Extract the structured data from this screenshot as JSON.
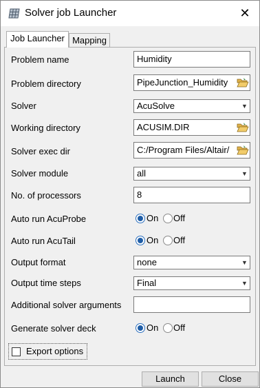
{
  "window": {
    "title": "Solver job Launcher"
  },
  "tabs": [
    {
      "label": "Job Launcher",
      "active": true
    },
    {
      "label": "Mapping",
      "active": false
    }
  ],
  "form": {
    "problem_name": {
      "label": "Problem name",
      "value": "Humidity"
    },
    "problem_directory": {
      "label": "Problem directory",
      "value": "PipeJunction_Humidity"
    },
    "solver": {
      "label": "Solver",
      "value": "AcuSolve"
    },
    "working_directory": {
      "label": "Working directory",
      "value": "ACUSIM.DIR"
    },
    "solver_exec_dir": {
      "label": "Solver exec dir",
      "value": "C:/Program Files/Altair/"
    },
    "solver_module": {
      "label": "Solver module",
      "value": "all"
    },
    "num_processors": {
      "label": "No. of processors",
      "value": "8"
    },
    "auto_run_acuprobe": {
      "label": "Auto run AcuProbe",
      "on_label": "On",
      "off_label": "Off",
      "selected": "On"
    },
    "auto_run_acutail": {
      "label": "Auto run AcuTail",
      "on_label": "On",
      "off_label": "Off",
      "selected": "On"
    },
    "output_format": {
      "label": "Output format",
      "value": "none"
    },
    "output_time_steps": {
      "label": "Output time steps",
      "value": "Final"
    },
    "additional_args": {
      "label": "Additional solver arguments",
      "value": ""
    },
    "generate_solver_deck": {
      "label": "Generate solver deck",
      "on_label": "On",
      "off_label": "Off",
      "selected": "On"
    },
    "export_options": {
      "label": "Export options",
      "checked": false
    }
  },
  "buttons": {
    "launch": "Launch",
    "close": "Close"
  },
  "icons": {
    "window": "grid-app-icon",
    "close": "close-icon",
    "folder": "folder-open-icon",
    "dropdown": "chevron-down-icon"
  },
  "colors": {
    "accent": "#1f5da6",
    "title_bar": "#ffffff",
    "panel": "#f0f0f0"
  }
}
